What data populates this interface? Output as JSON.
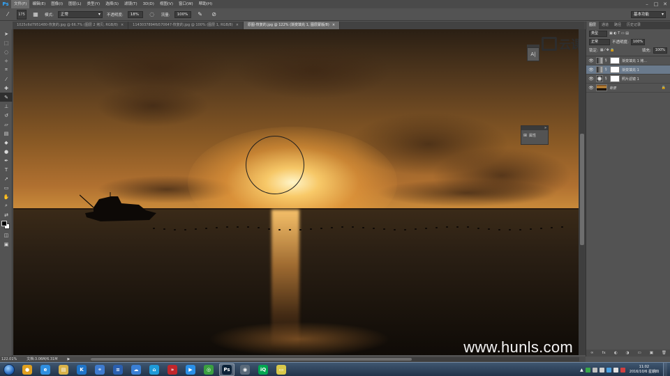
{
  "app": {
    "logo": "Ps"
  },
  "menu": [
    {
      "label": "文件(F)",
      "active": true
    },
    {
      "label": "编辑(E)"
    },
    {
      "label": "图像(I)"
    },
    {
      "label": "图层(L)"
    },
    {
      "label": "类型(Y)"
    },
    {
      "label": "选择(S)"
    },
    {
      "label": "滤镜(T)"
    },
    {
      "label": "3D(D)"
    },
    {
      "label": "视图(V)"
    },
    {
      "label": "窗口(W)"
    },
    {
      "label": "帮助(H)"
    }
  ],
  "window_controls": {
    "minimize": "–",
    "restore": "□",
    "close": "✕"
  },
  "options": {
    "brush_size": "175",
    "mode_label": "模式:",
    "mode_value": "正常",
    "opacity_label": "不透明度:",
    "opacity_value": "18%",
    "flow_label": "流量:",
    "flow_value": "100%",
    "workspace": "基本功能"
  },
  "tabs": [
    {
      "label": "1025c6d7951480-恢复的.jpg @ 66.7% (图层 2 拷贝, RGB/8)",
      "close": "×",
      "active": false
    },
    {
      "label": "1143037894fb570647-恢复的.jpg @ 100% (图层 1, RGB/8)",
      "close": "×",
      "active": false
    },
    {
      "label": "原图-恢复的.jpg @ 122% (渐变填充 1, 图层蒙版/8)",
      "close": "×",
      "active": true
    }
  ],
  "tab_overflow": "»",
  "floating": {
    "char_panel_icon": "A|",
    "props_panel_label": "属性",
    "props_panel_close": "»"
  },
  "overlay_logo_text": "云课堂",
  "watermark": "www.hunls.com",
  "panel": {
    "tabs": [
      "图层",
      "通道",
      "路径",
      "历史记录"
    ],
    "kind_label": "类型",
    "blend_mode": "正常",
    "opacity_label": "不透明度:",
    "opacity_value": "100%",
    "lock_label": "锁定:",
    "fill_label": "填充:",
    "fill_value": "100%",
    "layers": [
      {
        "name": "渐变填充 1 拷...",
        "type": "adjustment",
        "selected": false,
        "italic": false
      },
      {
        "name": "渐变填充 1",
        "type": "adjustment",
        "selected": true,
        "italic": false
      },
      {
        "name": "照片滤镜 1",
        "type": "filter",
        "selected": false,
        "italic": false
      },
      {
        "name": "背景",
        "type": "photo",
        "selected": false,
        "italic": true
      }
    ],
    "footer_icons": [
      "∞",
      "fx",
      "◐",
      "◑",
      "▭",
      "▣",
      "🗑"
    ]
  },
  "status": {
    "zoom": "122.01%",
    "doc_info": "文档:3.06M/6.31M",
    "arrow": "▶"
  },
  "taskbar": {
    "clock_time": "11:02",
    "clock_date": "2016/10/6 星期四",
    "apps": [
      {
        "name": "color-balls",
        "color": "#e0a020",
        "glyph": "●",
        "active": false
      },
      {
        "name": "ie",
        "color": "#2f8fe0",
        "glyph": "e",
        "active": false
      },
      {
        "name": "explorer",
        "color": "#d9b24a",
        "glyph": "▤",
        "active": false
      },
      {
        "name": "k-app",
        "color": "#1f74c8",
        "glyph": "K",
        "active": false
      },
      {
        "name": "network",
        "color": "#3e7bd0",
        "glyph": "⚭",
        "active": false
      },
      {
        "name": "list-app",
        "color": "#2a5fb0",
        "glyph": "≡",
        "active": false
      },
      {
        "name": "cloud-drive",
        "color": "#3a7fd5",
        "glyph": "☁",
        "active": false
      },
      {
        "name": "blue-cloud",
        "color": "#1e9ad8",
        "glyph": "⌂",
        "active": false
      },
      {
        "name": "red-arrows",
        "color": "#c0262b",
        "glyph": "»",
        "active": false
      },
      {
        "name": "media-player",
        "color": "#2a90e8",
        "glyph": "▶",
        "active": false
      },
      {
        "name": "green-app",
        "color": "#3aa040",
        "glyph": "◎",
        "active": false
      },
      {
        "name": "photoshop",
        "color": "#0c2238",
        "glyph": "Ps",
        "active": true
      },
      {
        "name": "camera-app",
        "color": "#5a6a7a",
        "glyph": "◉",
        "active": false
      },
      {
        "name": "iqiyi",
        "color": "#00a650",
        "glyph": "iQ",
        "active": false
      },
      {
        "name": "sticky-notes",
        "color": "#d8c84a",
        "glyph": "▭",
        "active": false
      }
    ]
  },
  "colors": {
    "ps_blue": "#31a8ff",
    "panel_bg": "#535353",
    "selected_layer": "#6a7a8c"
  }
}
